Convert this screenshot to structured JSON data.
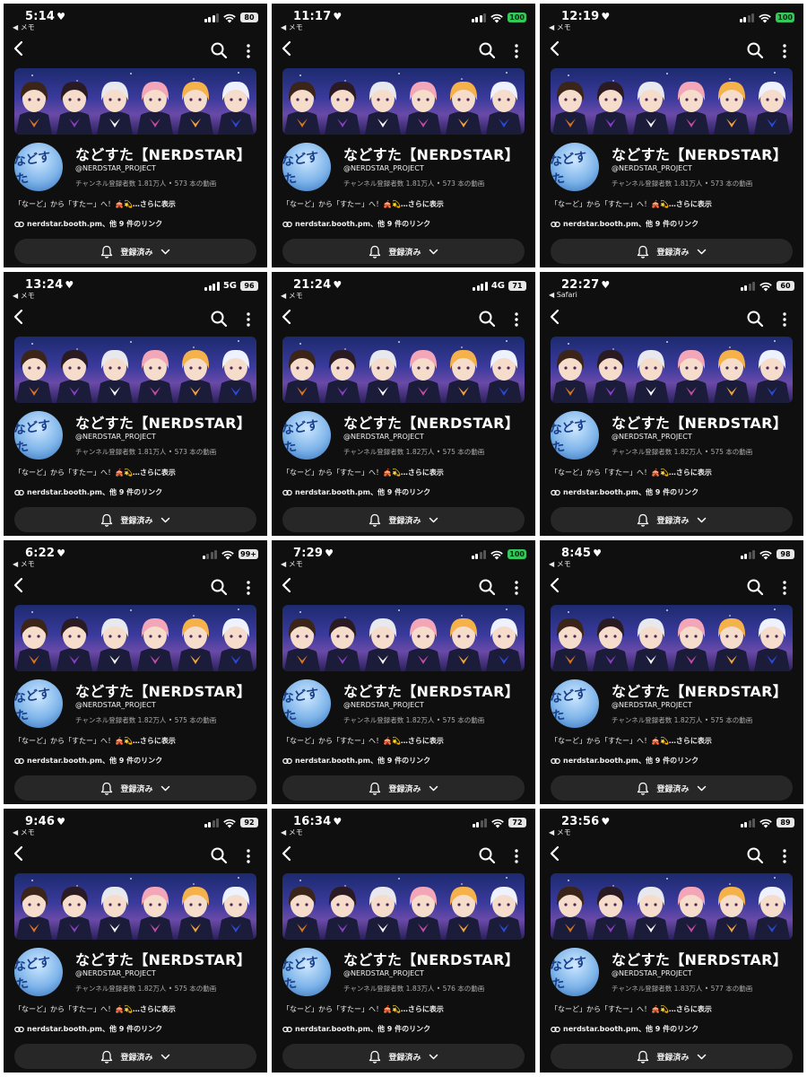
{
  "channel": {
    "name": "などすた【NERDSTAR】",
    "handle": "@NERDSTAR_PROJECT",
    "stats_subscribers_prefix": "チャンネル登録者数",
    "videos_suffix": "本の動画",
    "description": "「なーど」から「すたー」へ！",
    "description_emoji": "🎪💫",
    "show_more": "…さらに表示",
    "links": "nerdstar.booth.pm、他 9 件のリンク",
    "subscribe_label": "登録済み",
    "avatar_text": "などすた"
  },
  "icons": {
    "back": "chevron-left-icon",
    "search": "search-icon",
    "more": "more-vert-icon",
    "bell": "bell-icon",
    "link": "link-icon",
    "dropdown": "chevron-down-icon",
    "wifi": "wifi-icon",
    "signal": "cellular-signal-icon",
    "battery": "battery-icon"
  },
  "colors": {
    "background": "#0f0f0f",
    "button": "#272727",
    "battery_green": "#34c759"
  },
  "screenshots": [
    {
      "time": "5:14",
      "back_app": "◀ メモ",
      "net": "wifi",
      "signal": 3,
      "battery": "80",
      "battery_green": false,
      "subs": "1.81万人",
      "videos": "573"
    },
    {
      "time": "11:17",
      "back_app": "◀ メモ",
      "net": "wifi",
      "signal": 3,
      "battery": "100",
      "battery_green": true,
      "subs": "1.81万人",
      "videos": "573"
    },
    {
      "time": "12:19",
      "back_app": "◀ メモ",
      "net": "wifi",
      "signal": 2,
      "battery": "100",
      "battery_green": true,
      "subs": "1.81万人",
      "videos": "573"
    },
    {
      "time": "13:24",
      "back_app": "◀ メモ",
      "net": "5G",
      "signal": 4,
      "battery": "96",
      "battery_green": false,
      "subs": "1.81万人",
      "videos": "573"
    },
    {
      "time": "21:24",
      "back_app": "◀ メモ",
      "net": "4G",
      "signal": 4,
      "battery": "71",
      "battery_green": false,
      "subs": "1.82万人",
      "videos": "575"
    },
    {
      "time": "22:27",
      "back_app": "◀ Safari",
      "net": "wifi",
      "signal": 2,
      "battery": "60",
      "battery_green": false,
      "subs": "1.82万人",
      "videos": "575"
    },
    {
      "time": "6:22",
      "back_app": "◀ メモ",
      "net": "wifi",
      "signal": 1,
      "battery": "99+",
      "battery_green": false,
      "subs": "1.82万人",
      "videos": "575"
    },
    {
      "time": "7:29",
      "back_app": "◀ メモ",
      "net": "wifi",
      "signal": 2,
      "battery": "100",
      "battery_green": true,
      "subs": "1.82万人",
      "videos": "575"
    },
    {
      "time": "8:45",
      "back_app": "◀ メモ",
      "net": "wifi",
      "signal": 2,
      "battery": "98",
      "battery_green": false,
      "subs": "1.82万人",
      "videos": "575"
    },
    {
      "time": "9:46",
      "back_app": "◀ メモ",
      "net": "wifi",
      "signal": 2,
      "battery": "92",
      "battery_green": false,
      "subs": "1.82万人",
      "videos": "575"
    },
    {
      "time": "16:34",
      "back_app": "◀ メモ",
      "net": "wifi",
      "signal": 2,
      "battery": "72",
      "battery_green": false,
      "subs": "1.83万人",
      "videos": "576"
    },
    {
      "time": "23:56",
      "back_app": "◀ メモ",
      "net": "wifi",
      "signal": 2,
      "battery": "89",
      "battery_green": false,
      "subs": "1.83万人",
      "videos": "577"
    }
  ]
}
